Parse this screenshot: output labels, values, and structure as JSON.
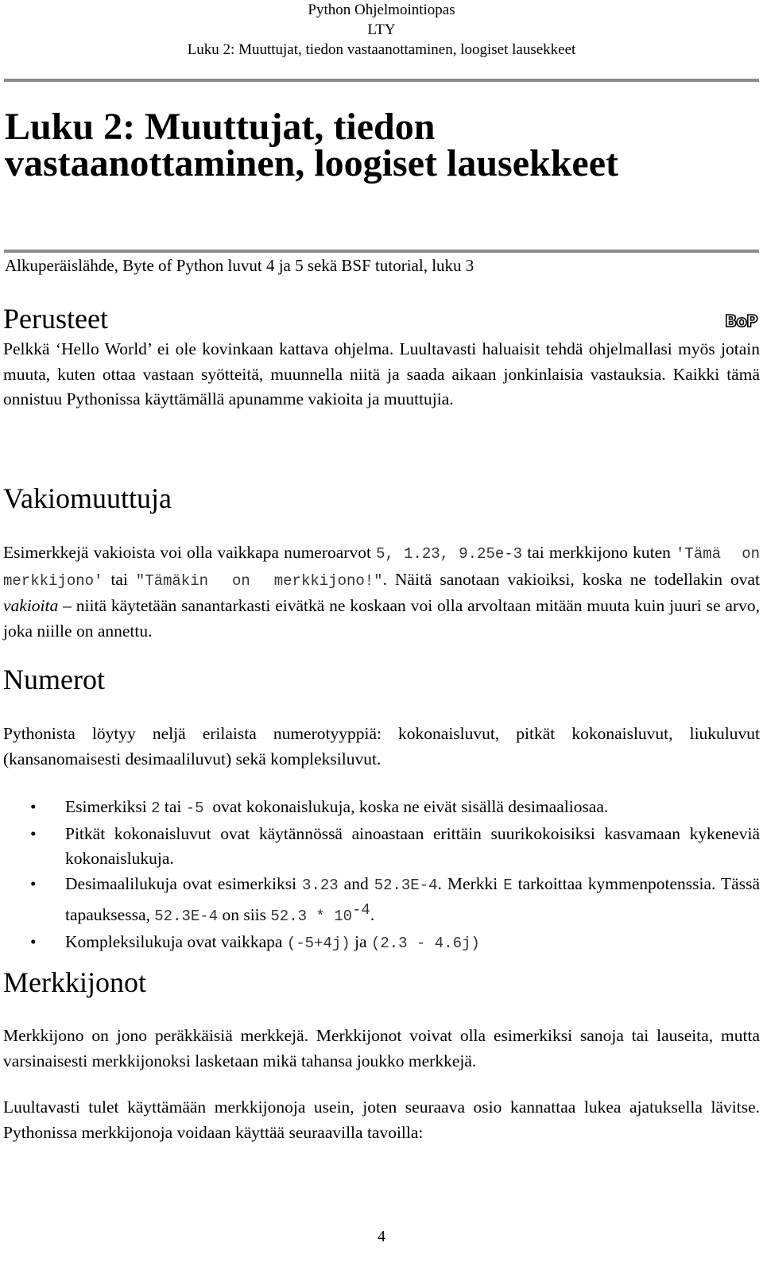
{
  "header": {
    "line1": "Python Ohjelmointiopas",
    "line2": "LTY",
    "line3": "Luku 2: Muuttujat, tiedon vastaanottaminen, loogiset lausekkeet"
  },
  "title": {
    "line1": "Luku 2: Muuttujat, tiedon",
    "line2": "vastaanottaminen, loogiset lausekkeet"
  },
  "source_note": "Alkuperäislähde, Byte of Python luvut 4 ja 5 sekä BSF tutorial, luku 3",
  "logo": {
    "text": "BoP",
    "icon": "bop-logo-icon"
  },
  "sections": {
    "perusteet": {
      "heading": "Perusteet",
      "paragraph": "Pelkkä ‘Hello World’ ei ole kovinkaan kattava ohjelma. Luultavasti haluaisit tehdä ohjelmallasi myös jotain muuta, kuten ottaa vastaan syötteitä, muunnella niitä ja saada aikaan jonkinlaisia vastauksia. Kaikki tämä onnistuu Pythonissa käyttämällä apunamme vakioita ja muuttujia."
    },
    "vakiomuuttuja": {
      "heading": "Vakiomuuttuja",
      "p_text1": "Esimerkkejä vakioista voi olla vaikkapa numeroarvot ",
      "code1": "5",
      "sep1": ", ",
      "code2": "1.23",
      "sep2": ", ",
      "code3": "9.25e-3",
      "p_text2": " tai merkkijono kuten ",
      "code4": "'Tämä on merkkijono'",
      "p_text3": " tai ",
      "code5": "\"Tämäkin on merkkijono!\"",
      "p_text4": ". Näitä sanotaan vakioiksi, koska ne todellakin ovat ",
      "emph": "vakioita",
      "p_text5": " – niitä käytetään sanantarkasti eivätkä ne koskaan voi olla arvoltaan mitään muuta kuin juuri se arvo, joka niille on annettu."
    },
    "numerot": {
      "heading": "Numerot",
      "paragraph": "Pythonista löytyy neljä erilaista numerotyyppiä: kokonaisluvut, pitkät kokonaisluvut, liukuluvut (kansanomaisesti desimaaliluvut) sekä kompleksiluvut.",
      "bullet": "•",
      "items": [
        {
          "t1": "Esimerkiksi ",
          "c1": "2",
          "t2": " tai ",
          "c2": "-5",
          "t3": "  ovat kokonaislukuja, koska ne eivät sisällä desimaaliosaa."
        },
        {
          "t1": "Pitkät kokonaisluvut ovat käytännössä ainoastaan erittäin suurikokoisiksi kasvamaan kykeneviä kokonaislukuja."
        },
        {
          "t1": "Desimaalilukuja ovat esimerkiksi ",
          "c1": "3.23",
          "t2": " and ",
          "c2": "52.3E-4",
          "t3": ". Merkki ",
          "c3": "E",
          "t4": " tarkoittaa kymmenpotenssia. Tässä tapauksessa, ",
          "c4": "52.3E-4",
          "t5": " on siis ",
          "c5": "52.3 * 10",
          "sup": "-4",
          "t6": "."
        },
        {
          "t1": "Kompleksilukuja ovat vaikkapa ",
          "c1": "(-5+4j)",
          "t2": " ja ",
          "c2": "(2.3 - 4.6j)"
        }
      ]
    },
    "merkkijonot": {
      "heading": "Merkkijonot",
      "paragraph1": "Merkkijono on jono peräkkäisiä merkkejä. Merkkijonot voivat olla esimerkiksi sanoja tai lauseita, mutta varsinaisesti merkkijonoksi lasketaan mikä tahansa joukko merkkejä.",
      "paragraph2": "Luultavasti tulet käyttämään merkkijonoja usein, joten seuraava osio kannattaa lukea ajatuksella lävitse. Pythonissa merkkijonoja voidaan käyttää seuraavilla tavoilla:"
    }
  },
  "page_number": "4"
}
